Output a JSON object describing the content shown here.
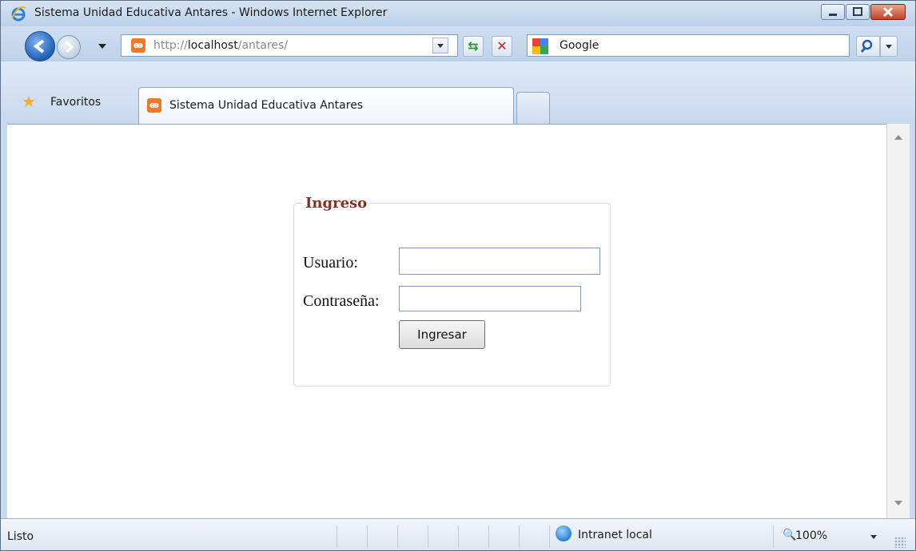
{
  "window": {
    "title": "Sistema Unidad Educativa Antares - Windows Internet Explorer",
    "controls": [
      "minimize-icon",
      "maximize-icon",
      "close-icon"
    ]
  },
  "addressbar": {
    "url_scheme": "http://",
    "url_host": "localhost",
    "url_path": "/antares/",
    "search_provider": "Google"
  },
  "tabs": {
    "favorites_label": "Favoritos",
    "active_tab_label": "Sistema Unidad Educativa Antares"
  },
  "login": {
    "legend": "Ingreso",
    "user_label": "Usuario:",
    "user_value": "",
    "password_label": "Contraseña:",
    "password_value": "",
    "submit_label": "Ingresar"
  },
  "status": {
    "text": "Listo",
    "zone": "Intranet local",
    "zoom": "100%"
  },
  "colors": {
    "legend": "#8b2e1e",
    "chrome": "#c9daee",
    "input_border": "#7f9db9"
  }
}
